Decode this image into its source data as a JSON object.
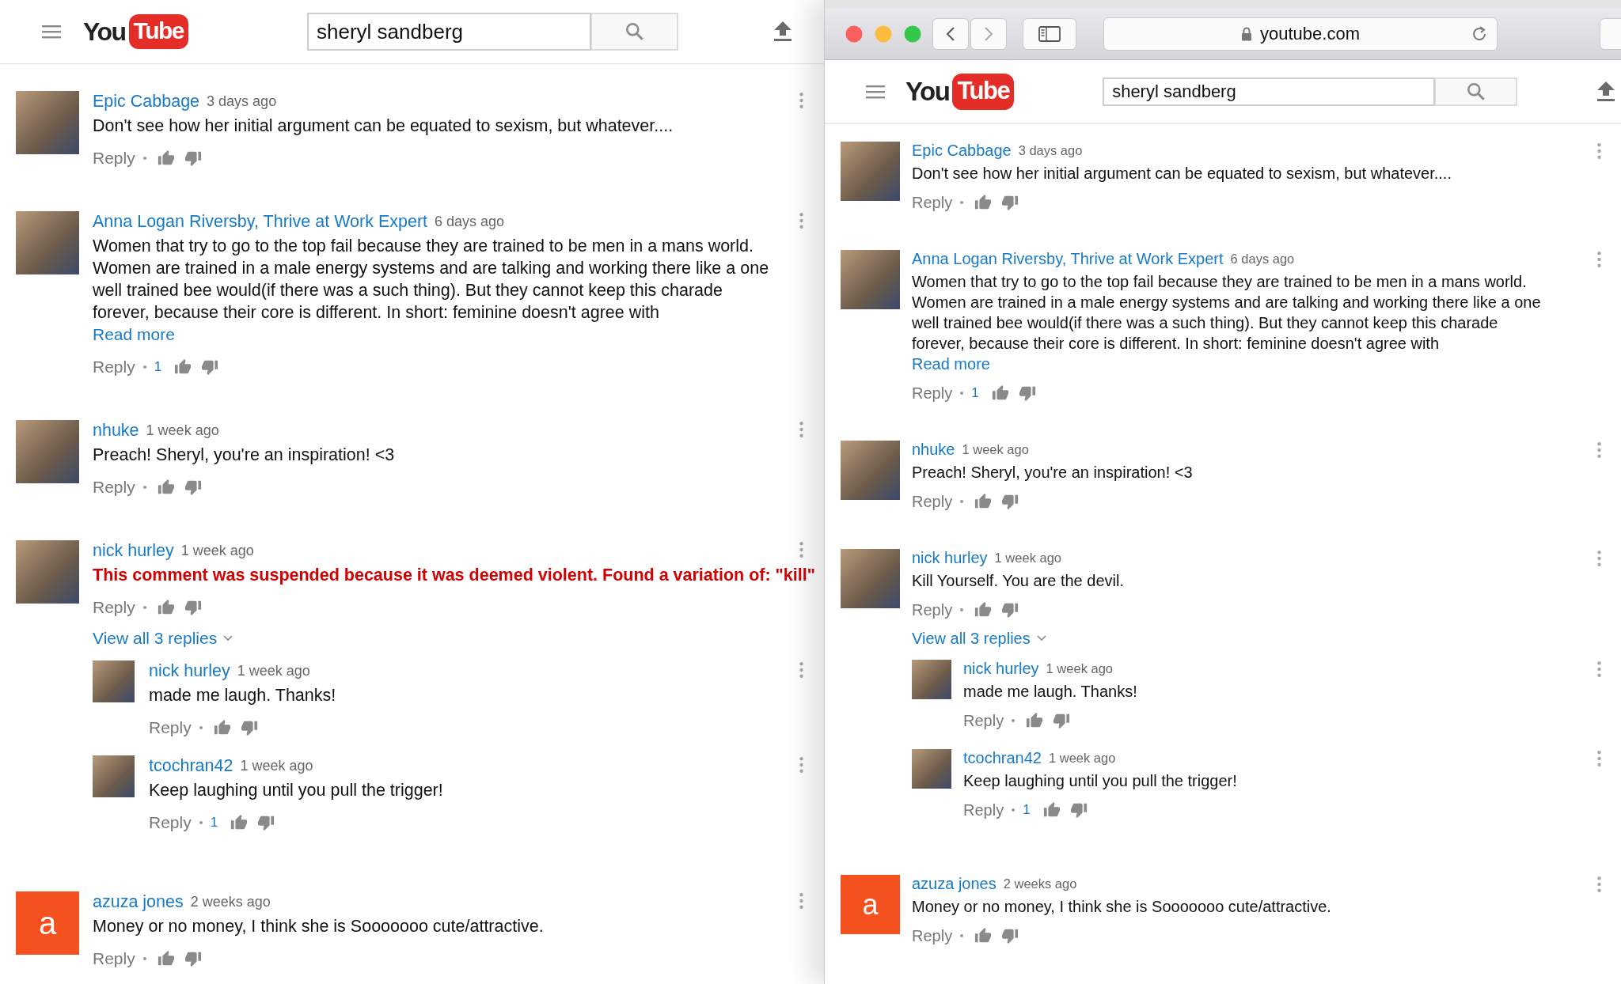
{
  "panes": [
    {
      "kind": "plain",
      "header": {
        "logo_you": "You",
        "logo_tube": "Tube",
        "search_value": "sheryl sandberg"
      },
      "comments": [
        {
          "author": "Epic Cabbage",
          "time": "3 days ago",
          "avatar": {
            "kind": "photo"
          },
          "kind": "normal",
          "text": "Don't see how her initial argument can be equated to sexism, but whatever....",
          "reply_label": "Reply"
        },
        {
          "author": "Anna Logan Riversby, Thrive at Work Expert",
          "time": "6 days ago",
          "avatar": {
            "kind": "photo"
          },
          "kind": "normal",
          "text": "Women that try to go to the top fail because they are trained to be men in a mans world.\nWomen are trained in a male energy systems and are talking and working there like a one\nwell trained bee would(if there was a such thing). But they cannot keep this charade\nforever, because their core is different. In short: feminine doesn't agree with",
          "read_more": "Read more",
          "reply_label": "Reply",
          "likes": "1"
        },
        {
          "author": "nhuke",
          "time": "1 week ago",
          "avatar": {
            "kind": "photo"
          },
          "kind": "normal",
          "text": "Preach! Sheryl, you're an inspiration! <3",
          "reply_label": "Reply"
        },
        {
          "author": "nick hurley",
          "time": "1 week ago",
          "avatar": {
            "kind": "photo"
          },
          "kind": "suspended",
          "text": "This comment was suspended because it was deemed violent. Found a variation of: \"kill\"",
          "reply_label": "Reply",
          "view_replies": "View all 3 replies",
          "replies": [
            {
              "author": "nick hurley",
              "time": "1 week ago",
              "avatar": {
                "kind": "photo"
              },
              "kind": "normal",
              "text": "made me laugh. Thanks!",
              "reply_label": "Reply"
            },
            {
              "author": "tcochran42",
              "time": "1 week ago",
              "avatar": {
                "kind": "photo"
              },
              "kind": "normal",
              "text": "Keep laughing until you pull the trigger!",
              "reply_label": "Reply",
              "likes": "1"
            }
          ]
        },
        {
          "author": "azuza jones",
          "time": "2 weeks ago",
          "avatar": {
            "kind": "letter",
            "letter": "a"
          },
          "kind": "normal",
          "text": "Money or no money, I think she is Sooooooo cute/attractive.",
          "reply_label": "Reply"
        }
      ]
    },
    {
      "kind": "browser",
      "browser": {
        "url": "youtube.com"
      },
      "header": {
        "logo_you": "You",
        "logo_tube": "Tube",
        "search_value": "sheryl sandberg"
      },
      "comments": [
        {
          "author": "Epic Cabbage",
          "time": "3 days ago",
          "avatar": {
            "kind": "photo"
          },
          "kind": "normal",
          "text": "Don't see how her initial argument can be equated to sexism, but whatever....",
          "reply_label": "Reply"
        },
        {
          "author": "Anna Logan Riversby, Thrive at Work Expert",
          "time": "6 days ago",
          "avatar": {
            "kind": "photo"
          },
          "kind": "normal",
          "text": "Women that try to go to the top fail because they are trained to be men in a mans world.\nWomen are trained in a male energy systems and are talking and working there like a one\nwell trained bee would(if there was a such thing). But they cannot keep this charade\nforever, because their core is different. In short: feminine doesn't agree with",
          "read_more": "Read more",
          "reply_label": "Reply",
          "likes": "1"
        },
        {
          "author": "nhuke",
          "time": "1 week ago",
          "avatar": {
            "kind": "photo"
          },
          "kind": "normal",
          "text": "Preach! Sheryl, you're an inspiration! <3",
          "reply_label": "Reply"
        },
        {
          "author": "nick hurley",
          "time": "1 week ago",
          "avatar": {
            "kind": "photo"
          },
          "kind": "normal",
          "text": "Kill Yourself. You are the devil.",
          "reply_label": "Reply",
          "view_replies": "View all 3 replies",
          "replies": [
            {
              "author": "nick hurley",
              "time": "1 week ago",
              "avatar": {
                "kind": "photo"
              },
              "kind": "normal",
              "text": "made me laugh. Thanks!",
              "reply_label": "Reply"
            },
            {
              "author": "tcochran42",
              "time": "1 week ago",
              "avatar": {
                "kind": "photo"
              },
              "kind": "normal",
              "text": "Keep laughing until you pull the trigger!",
              "reply_label": "Reply",
              "likes": "1"
            }
          ]
        },
        {
          "author": "azuza jones",
          "time": "2 weeks ago",
          "avatar": {
            "kind": "letter",
            "letter": "a"
          },
          "kind": "normal",
          "text": "Money or no money, I think she is Sooooooo cute/attractive.",
          "reply_label": "Reply"
        }
      ]
    }
  ]
}
